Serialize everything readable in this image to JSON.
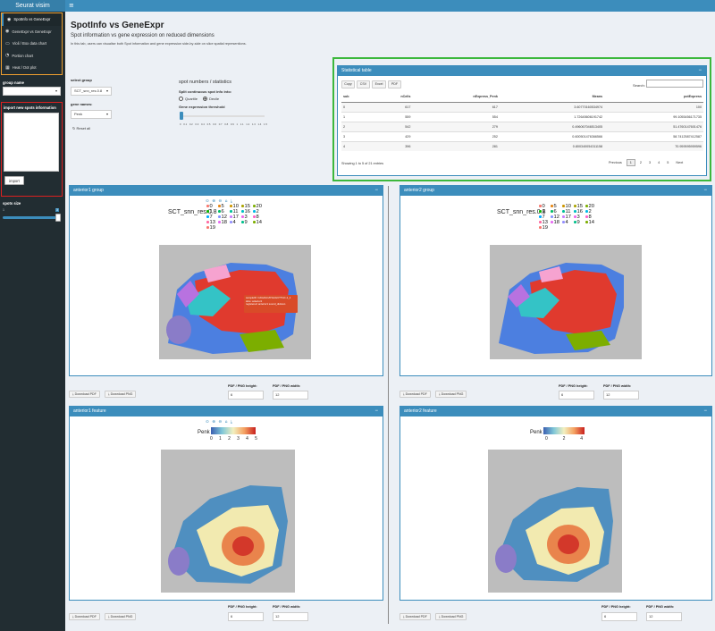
{
  "app": {
    "title": "Seurat visim",
    "menu_icon": "hamburger-icon"
  },
  "sidebar": {
    "menu": [
      {
        "label": "SpotInfo vs GeneExpr",
        "icon": "dashboard-icon",
        "active": true
      },
      {
        "label": "GeneExpr vs GeneExpr",
        "icon": "dashboard-icon",
        "active": false
      },
      {
        "label": "Violi / Box data chart",
        "icon": "chart-icon",
        "active": false
      },
      {
        "label": "Portion chart",
        "icon": "pie-icon",
        "active": false
      },
      {
        "label": "Heat / Dot plot",
        "icon": "grid-icon",
        "active": false
      }
    ],
    "group_name_label": "group name",
    "import_label": "import new spots information",
    "import_button": "import",
    "spots_size_label": "spots size",
    "spots_size_min": "1",
    "spots_size_max": "3",
    "spots_size_value": 1.0
  },
  "main": {
    "title": "SpotInfo vs GeneExpr",
    "subtitle": "Spot information vs gene expression on reduced dimensions",
    "description": "In this tab, users can visualise both Spot information and gene expression side-by-side on slice spatial representions.",
    "select_group_label": "select group",
    "select_group_value": "SCT_snn_res.0.8",
    "gene_names_label": "gene names:",
    "gene_names_value": "Penk",
    "reset_label": "Reset all",
    "stats_heading": "spot numbers / statistics",
    "split_label": "Split continuous spot info into:",
    "radio_quartile": "Quartile",
    "radio_decile": "Decile",
    "threshold_label": "Gene expression threshold",
    "threshold_ticks": [
      "0",
      "0.1",
      "0.2",
      "0.3",
      "0.4",
      "0.5",
      "0.6",
      "0.7",
      "0.8",
      "0.9",
      "1",
      "1.1",
      "1.2",
      "1.3",
      "1.4",
      "1.5"
    ]
  },
  "stat_table": {
    "title": "Statistical table",
    "buttons": {
      "copy": "Copy",
      "csv": "CSV",
      "excel": "Excel",
      "pdf": "PDF"
    },
    "search_label": "Search:",
    "columns": [
      "sub",
      "nCells",
      "nExpress_Penk",
      "Means",
      "pctExpress"
    ],
    "rows": [
      [
        "0",
        "617",
        "617",
        "3.60770160534974",
        "100"
      ],
      [
        "1",
        "559",
        "554",
        "1.72645606191742",
        "99.1055456171735"
      ],
      [
        "2",
        "542",
        "279",
        "0.496067046513405",
        "51.4760147601476"
      ],
      [
        "3",
        "429",
        "252",
        "0.600501476366566",
        "58.7412587412587"
      ],
      [
        "4",
        "396",
        "281",
        "0.800340054311158",
        "70.959595959596"
      ]
    ],
    "info": "Showing 1 to 5 of 21 entries",
    "pager": [
      "Previous",
      "1",
      "2",
      "3",
      "4",
      "5",
      "Next"
    ]
  },
  "panels": {
    "group1_title": "anterior1 group",
    "group2_title": "anterior2 group",
    "feature1_title": "anterior1 feature",
    "feature2_title": "anterior2 feature",
    "legend_title": "SCT_snn_res.0.8",
    "legend_items": [
      "0",
      "5",
      "10",
      "15",
      "20",
      "1",
      "6",
      "11",
      "16",
      "2",
      "7",
      "12",
      "17",
      "3",
      "8",
      "13",
      "18",
      "4",
      "9",
      "14",
      "19"
    ],
    "legend_colors": [
      "#f8766d",
      "#e68613",
      "#cd9600",
      "#aba300",
      "#7cae00",
      "#0cb702",
      "#00be67",
      "#00c19a",
      "#00bfc4",
      "#00b8e7",
      "#00a9ff",
      "#8494ff",
      "#c77cff",
      "#ed68ed",
      "#ff61cc",
      "#ff68a1",
      "#e76bf3",
      "#9590ff",
      "#00c08b",
      "#7cae00",
      "#f8766d"
    ],
    "feature_label": "Penk",
    "feature1_ticks": [
      "0",
      "1",
      "2",
      "3",
      "4",
      "5"
    ],
    "feature2_ticks": [
      "0",
      "2",
      "4"
    ],
    "tooltip": "sampleID: CAGAGCATGAGCTTGC-1_1\nslice: anterior1\nregistered: anterior1 sound_division",
    "download_pdf": "Download PDF",
    "download_png": "Download PNG",
    "height_label": "PDF / PNG height:",
    "width_label": "PDF / PNG width:",
    "height_value": "6",
    "width_value": "12",
    "tool_icons": "⊙ ⊕ ⊖ ⌂ ⤓"
  },
  "colors": {
    "header": "#3c8dbc",
    "sidebar": "#222d32",
    "accent_orange": "#f0a030",
    "accent_red": "#dd2020",
    "accent_green": "#3cb83c"
  }
}
